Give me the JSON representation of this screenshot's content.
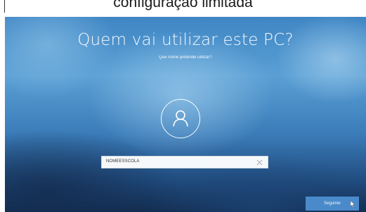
{
  "caption": {
    "text": "configuração limitada"
  },
  "screen": {
    "title": "Quem vai utilizar este PC?",
    "subtitle": "Que nome pretende utilizar?",
    "avatar_icon": "user-avatar-icon",
    "name_field": {
      "value": "NOMEESSCOLA",
      "clear_icon": "close-icon"
    },
    "next_button": {
      "label": "Seguinte"
    },
    "cursor_icon": "mouse-pointer-icon"
  },
  "colors": {
    "background_blue": "#3f86c4",
    "button_blue": "#4d8fd0",
    "text_white": "#ffffff"
  }
}
